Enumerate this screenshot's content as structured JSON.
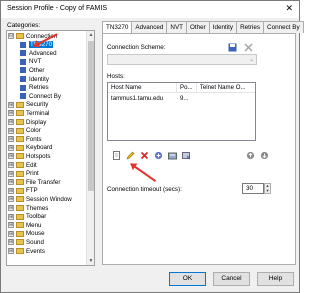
{
  "window": {
    "title": "Session Profile - Copy of FAMIS",
    "close_glyph": "✕"
  },
  "categories": {
    "label": "Categories:",
    "items": [
      {
        "label": "Connection",
        "expander": "⊟",
        "kind": "folder",
        "indent": 0
      },
      {
        "label": "TN3270",
        "expander": "",
        "kind": "leaf",
        "indent": 1,
        "selected": true
      },
      {
        "label": "Advanced",
        "expander": "",
        "kind": "leaf",
        "indent": 1
      },
      {
        "label": "NVT",
        "expander": "",
        "kind": "leaf",
        "indent": 1
      },
      {
        "label": "Other",
        "expander": "",
        "kind": "leaf",
        "indent": 1
      },
      {
        "label": "Identity",
        "expander": "",
        "kind": "leaf",
        "indent": 1
      },
      {
        "label": "Retries",
        "expander": "",
        "kind": "leaf",
        "indent": 1
      },
      {
        "label": "Connect By",
        "expander": "",
        "kind": "leaf",
        "indent": 1
      },
      {
        "label": "Security",
        "expander": "⊞",
        "kind": "folder",
        "indent": 0
      },
      {
        "label": "Terminal",
        "expander": "⊞",
        "kind": "folder",
        "indent": 0
      },
      {
        "label": "Display",
        "expander": "⊞",
        "kind": "folder",
        "indent": 0
      },
      {
        "label": "Color",
        "expander": "⊞",
        "kind": "folder",
        "indent": 0
      },
      {
        "label": "Fonts",
        "expander": "⊞",
        "kind": "folder",
        "indent": 0
      },
      {
        "label": "Keyboard",
        "expander": "⊞",
        "kind": "folder",
        "indent": 0
      },
      {
        "label": "Hotspots",
        "expander": "⊞",
        "kind": "folder",
        "indent": 0
      },
      {
        "label": "Edit",
        "expander": "⊞",
        "kind": "folder",
        "indent": 0
      },
      {
        "label": "Print",
        "expander": "⊞",
        "kind": "folder",
        "indent": 0
      },
      {
        "label": "File Transfer",
        "expander": "⊞",
        "kind": "folder",
        "indent": 0
      },
      {
        "label": "FTP",
        "expander": "⊞",
        "kind": "folder",
        "indent": 0
      },
      {
        "label": "Session Window",
        "expander": "⊞",
        "kind": "folder",
        "indent": 0
      },
      {
        "label": "Themes",
        "expander": "⊞",
        "kind": "folder",
        "indent": 0
      },
      {
        "label": "Toolbar",
        "expander": "⊞",
        "kind": "folder",
        "indent": 0
      },
      {
        "label": "Menu",
        "expander": "⊞",
        "kind": "folder",
        "indent": 0
      },
      {
        "label": "Mouse",
        "expander": "⊞",
        "kind": "folder",
        "indent": 0
      },
      {
        "label": "Sound",
        "expander": "⊞",
        "kind": "folder",
        "indent": 0
      },
      {
        "label": "Events",
        "expander": "⊞",
        "kind": "folder",
        "indent": 0
      }
    ]
  },
  "tabs": [
    {
      "label": "TN3270",
      "active": true
    },
    {
      "label": "Advanced"
    },
    {
      "label": "NVT"
    },
    {
      "label": "Other"
    },
    {
      "label": "Identity"
    },
    {
      "label": "Retries"
    },
    {
      "label": "Connect By"
    }
  ],
  "connection": {
    "scheme_label": "Connection Scheme:",
    "scheme_value": "",
    "hosts_label": "Hosts:",
    "columns": [
      "Host Name",
      "Po...",
      "Telnet Name O..."
    ],
    "rows": [
      {
        "host": "tammus1.tamu.edu",
        "port": "9...",
        "telnet": ""
      }
    ],
    "toolbar_icons": [
      "new-icon",
      "edit-icon",
      "delete-icon",
      "add-icon",
      "import-icon",
      "export-icon",
      "move-up-icon",
      "move-down-icon"
    ],
    "timeout_label": "Connection timeout (secs):",
    "timeout_value": "30"
  },
  "buttons": {
    "ok": "OK",
    "cancel": "Cancel",
    "help": "Help"
  },
  "colors": {
    "annotation_arrow": "#e3342f",
    "selection": "#0078d7"
  }
}
